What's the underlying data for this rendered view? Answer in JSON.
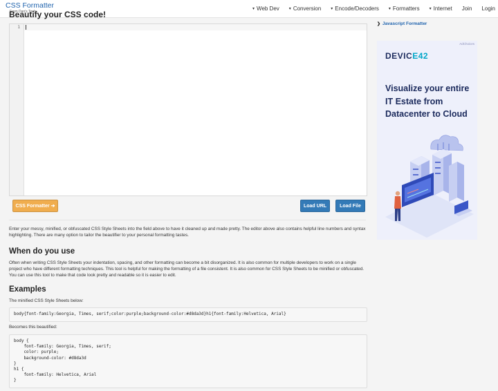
{
  "brand": {
    "name": "CSS Formatter",
    "sub": "From Dan's Tools"
  },
  "nav": [
    {
      "label": "Web Dev",
      "has_menu": true
    },
    {
      "label": "Conversion",
      "has_menu": true
    },
    {
      "label": "Encode/Decoders",
      "has_menu": true
    },
    {
      "label": "Formatters",
      "has_menu": true
    },
    {
      "label": "Internet",
      "has_menu": true
    },
    {
      "label": "Join",
      "has_menu": false
    },
    {
      "label": "Login",
      "has_menu": false
    }
  ],
  "page": {
    "clipped_title": "Beautify your CSS code!"
  },
  "editor": {
    "line_number": "1",
    "content": ""
  },
  "buttons": {
    "format": "CSS Formatter",
    "load_url": "Load URL",
    "load_file": "Load File"
  },
  "intro": "Enter your messy, minified, or obfuscated CSS Style Sheets into the field above to have it cleaned up and made pretty. The editor above also contains helpful line numbers and syntax highlighting. There are many option to tailor the beautifier to your personal formatting tastes.",
  "when": {
    "heading": "When do you use",
    "text": "Often when writing CSS Style Sheets your indentation, spacing, and other formatting can become a bit disorganized. It is also common for multiple developers to work on a single project who have different formatting techniques. This tool is helpful for making the formatting of a file consistent. It is also common for CSS Style Sheets to be minified or obfuscated. You can use this tool to make that code look pretty and readable so it is easier to edit."
  },
  "examples": {
    "heading": "Examples",
    "minified_label": "The minified CSS Style Sheets below:",
    "minified_code": "body{font-family:Georgia, Times, serif;color:purple;background-color:#d8da3d}h1{font-family:Helvetica, Arial}",
    "becomes_label": "Becomes this beautified:",
    "beautified_code": "body {\n    font-family: Georgia, Times, serif;\n    color: purple;\n    background-color: #d8da3d\n}\nh1 {\n    font-family: Helvetica, Arial\n}"
  },
  "sidebar": {
    "link": "Javascript Formatter"
  },
  "ad": {
    "adchoices": "AdChoices",
    "logo_a": "DEVIC",
    "logo_b": "E42",
    "headline": "Visualize your entire IT Estate from Datacenter to Cloud"
  },
  "colors": {
    "brand": "#1f63ad",
    "format_button": "#f0ad4e",
    "load_buttons": "#337ab7",
    "ad_text": "#1b2a5c",
    "ad_accent": "#00a6c8"
  }
}
